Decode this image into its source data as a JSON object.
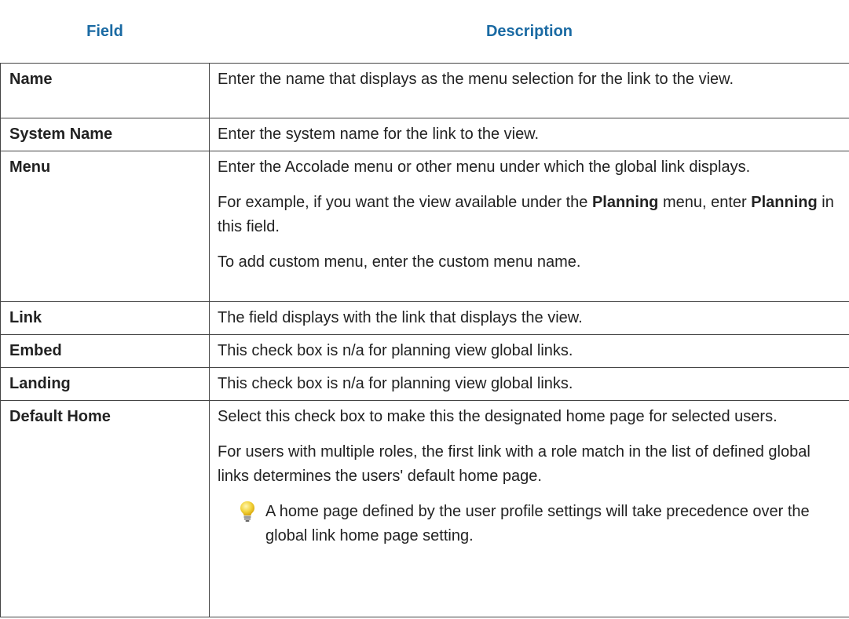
{
  "header": {
    "field": "Field",
    "description": "Description"
  },
  "rows": [
    {
      "field": "Name",
      "desc": [
        "Enter the name that displays as the menu selection for the link to the view."
      ]
    },
    {
      "field": "System Name",
      "desc": [
        "Enter the system name for the link to the view."
      ]
    },
    {
      "field": "Menu",
      "desc": [
        "Enter the Accolade menu or other menu under which the global link displays."
      ],
      "example": {
        "pre": "For example, if you want the view available under the ",
        "bold1": "Planning",
        "mid": " menu, enter ",
        "bold2": "Planning",
        "post": " in this field."
      },
      "desc_after": "To add custom menu, enter the custom menu name."
    },
    {
      "field": "Link",
      "desc": [
        "The field displays with the link that displays the view."
      ]
    },
    {
      "field": "Embed",
      "desc": [
        "This check box is n/a for planning view global links."
      ]
    },
    {
      "field": "Landing",
      "desc": [
        "This check box is n/a for planning view global links."
      ]
    },
    {
      "field": "Default Home",
      "desc": [
        "Select this check box to make this the designated home page for selected users.",
        "For users with multiple roles, the first link with a role match in the list of defined global links determines the users' default home page."
      ],
      "note": {
        "icon": "lightbulb-icon",
        "text": "A home page defined by the user profile settings will take precedence over the global link home page setting."
      }
    }
  ],
  "colors": {
    "header_text": "#1a6aa3",
    "bulb": "#f2d33c"
  }
}
